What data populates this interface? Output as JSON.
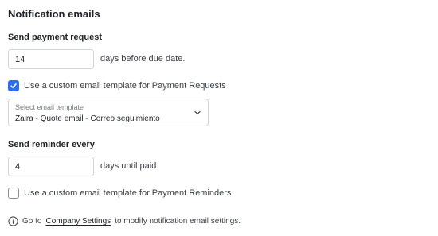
{
  "title": "Notification emails",
  "payment_request": {
    "label": "Send payment request",
    "days_value": "14",
    "days_suffix": "days before due date.",
    "custom_template_checked": true,
    "custom_template_label": "Use a custom email template for Payment Requests",
    "template_select": {
      "label": "Select email template",
      "value": "Zaira - Quote email - Correo seguimiento"
    }
  },
  "reminder": {
    "label": "Send reminder every",
    "days_value": "4",
    "days_suffix": "days until paid.",
    "custom_template_checked": false,
    "custom_template_label": "Use a custom email template for Payment Reminders"
  },
  "footer": {
    "prefix": "Go to",
    "link": "Company Settings",
    "suffix": "to modify notification email settings."
  },
  "colors": {
    "accent": "#2f6df6",
    "border": "#d0d4da"
  }
}
